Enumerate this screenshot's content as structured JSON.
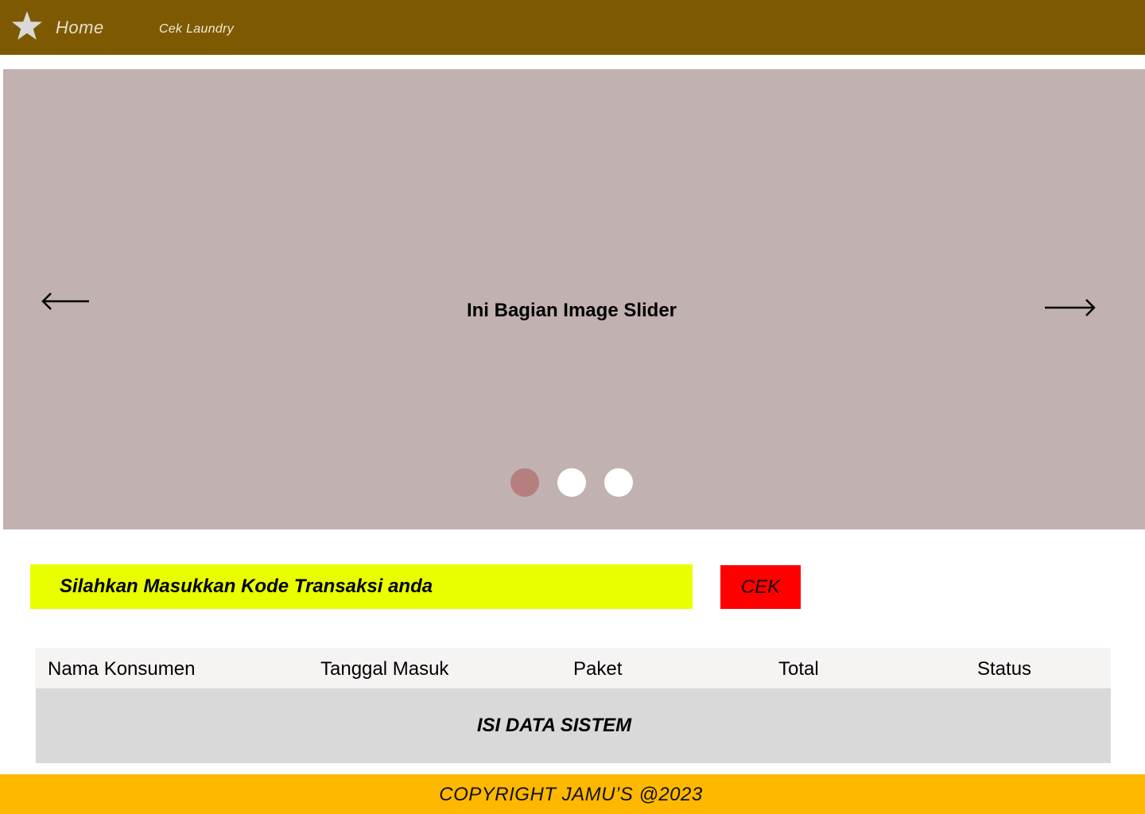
{
  "navbar": {
    "logo_icon": "star-icon",
    "home_label": "Home",
    "cek_label": "Cek Laundry",
    "background": "#7d5a01"
  },
  "slider": {
    "caption": "Ini Bagian Image Slider",
    "prev_icon": "arrow-left-icon",
    "next_icon": "arrow-right-icon",
    "active_index": 0,
    "dot_count": 3,
    "background": "#c2b1b1",
    "active_dot_color": "#b67f7f"
  },
  "transaction": {
    "placeholder": "Silahkan Masukkan Kode Transaksi anda",
    "value": "",
    "button_label": "CEK",
    "input_color": "#e9ff00",
    "button_color": "#ff0000"
  },
  "table": {
    "columns": [
      "Nama Konsumen",
      "Tanggal Masuk",
      "Paket",
      "Total",
      "Status"
    ],
    "body_text": "ISI DATA SISTEM"
  },
  "footer": {
    "text": "COPYRIGHT JAMU’S @2023",
    "background": "#ffb800"
  }
}
